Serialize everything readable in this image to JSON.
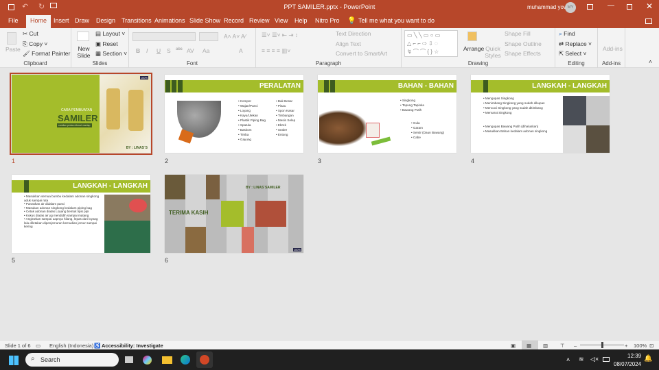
{
  "window": {
    "title": "PPT SAMILER.pptx  -  PowerPoint",
    "user": "muhammad yova",
    "avatar": "MY"
  },
  "tabs": [
    "File",
    "Home",
    "Insert",
    "Draw",
    "Design",
    "Transitions",
    "Animations",
    "Slide Show",
    "Record",
    "Review",
    "View",
    "Help",
    "Nitro Pro"
  ],
  "tell_me": "Tell me what you want to do",
  "ribbon": {
    "clipboard": {
      "paste": "Paste",
      "cut": "Cut",
      "copy": "Copy",
      "format_painter": "Format Painter",
      "label": "Clipboard"
    },
    "slides": {
      "new_slide": "New Slide",
      "layout": "Layout",
      "reset": "Reset",
      "section": "Section",
      "label": "Slides"
    },
    "font": {
      "label": "Font",
      "bold": "B",
      "italic": "I",
      "underline": "U",
      "shadow": "S",
      "strike": "abc",
      "spacing": "AV",
      "case": "Aa",
      "color": "A"
    },
    "paragraph": {
      "text_direction": "Text Direction",
      "align_text": "Align Text",
      "convert": "Convert to SmartArt",
      "label": "Paragraph"
    },
    "drawing": {
      "arrange": "Arrange",
      "quick_styles": "Quick Styles",
      "shape_fill": "Shape Fill",
      "shape_outline": "Shape Outline",
      "shape_effects": "Shape Effects",
      "label": "Drawing"
    },
    "editing": {
      "find": "Find",
      "replace": "Replace",
      "select": "Select",
      "label": "Editing"
    },
    "addins": {
      "button": "Add-ins",
      "label": "Add-ins"
    }
  },
  "slides": [
    {
      "number": "1",
      "pre": "CARA PEMBUATAN",
      "title": "SAMILER",
      "sub": "camilan pedas nikmat mantap",
      "by": "BY : LINAS`S",
      "logo": "100%"
    },
    {
      "number": "2",
      "title": "PERALATAN",
      "col1": [
        "Kompor",
        "Wajan/Panci",
        "Loyang",
        "Kayu/Ulekan",
        "Plastik Piping Bag",
        "Spatula",
        "Baskom",
        "Timba",
        "Gayung"
      ],
      "col2": [
        "Bak Besar",
        "Pisau",
        "Spon Kasar",
        "Timbangan",
        "Mesin Selep",
        "Ebrek",
        "Sealer",
        "Entong"
      ]
    },
    {
      "number": "3",
      "title": "BAHAN - BAHAN",
      "col1": [
        "Singkong",
        "Tepung Tapioka",
        "Bawang Putih"
      ],
      "col2": [
        "Gula",
        "Garam",
        "Sentir (Daun Bawang)",
        "Cabe"
      ]
    },
    {
      "number": "4",
      "title": "LANGKAH - LANGKAH",
      "col1": [
        "Mengupas Singkong",
        "Menimbang Singkong yang sudah dikupas",
        "Mencuci Singkong yang sudah ditimbang",
        "Memarut Singkong"
      ],
      "col2": [
        "Mengupas Bawang  Putih (dihaluskan)",
        "Masukkan Bahan kedalam adonan singkong"
      ]
    },
    {
      "number": "5",
      "title": "LANGKAH - LANGKAH",
      "col1": [
        "Masukkan semua bumbu kedalam adonan singkong  aduk sampai rata",
        "Panaskan air didalam panci",
        "Masukan adonan singkong kedalam piping bag",
        "Cetak adonan diatas Loyang bentuk tipis pipi",
        "Kukus diatas air yg mendidih sampai matang",
        "Angin2kan sampai uapnya hilang, lepas dari loyang lalu diletakan dipenjemuran kemudian jemur sampai kering"
      ]
    },
    {
      "number": "6",
      "title": "TERIMA KASIH",
      "by": "BY : LINAS`SAMILER",
      "logo": "100%"
    }
  ],
  "status": {
    "slide": "Slide 1 of 6",
    "language": "English (Indonesia)",
    "accessibility": "Accessibility: Investigate",
    "zoom": "100%",
    "zoom_level": 100
  },
  "taskbar": {
    "search": "Search",
    "time": "12:39",
    "date": "08/07/2024"
  },
  "colors": {
    "accent": "#b7472a",
    "slide_green": "#a4bd2b",
    "dark_green": "#3e5c1f"
  }
}
